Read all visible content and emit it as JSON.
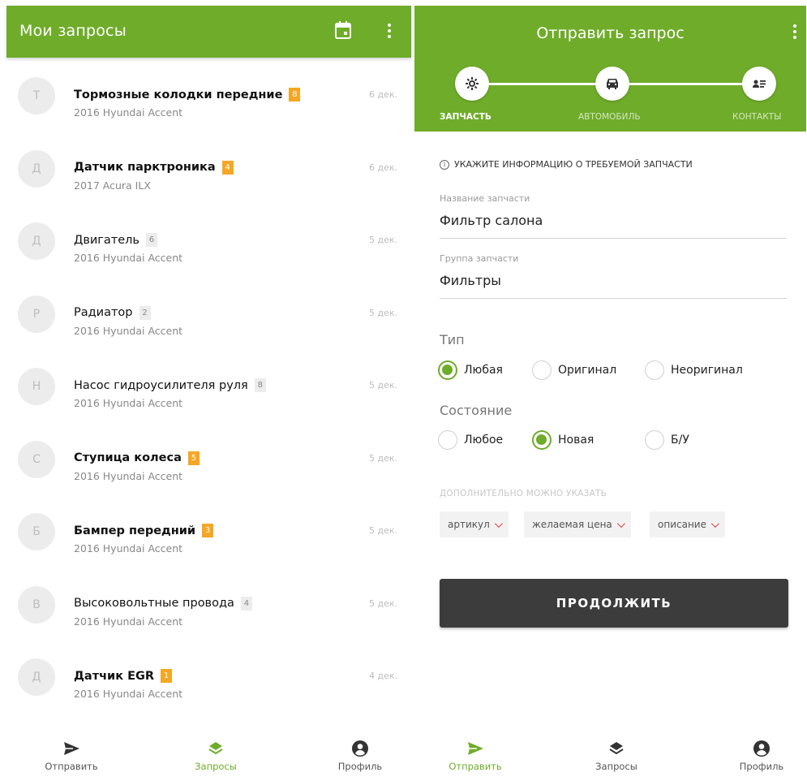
{
  "left": {
    "title": "Мои запросы",
    "icons": {
      "calendar": "calendar-icon",
      "more": "more-vert-icon"
    },
    "requests": [
      {
        "avatar": "Т",
        "name": "Тормозные колодки передние",
        "bold": true,
        "badge": "8",
        "badge_style": "orange",
        "car": "2016 Hyundai Accent",
        "date": "6 дек."
      },
      {
        "avatar": "Д",
        "name": "Датчик парктроника",
        "bold": true,
        "badge": "4",
        "badge_style": "orange",
        "car": "2017 Acura ILX",
        "date": "6 дек."
      },
      {
        "avatar": "Д",
        "name": "Двигатель",
        "bold": false,
        "badge": "6",
        "badge_style": "gray",
        "car": "2016 Hyundai Accent",
        "date": "5 дек."
      },
      {
        "avatar": "Р",
        "name": "Радиатор",
        "bold": false,
        "badge": "2",
        "badge_style": "gray",
        "car": "2016 Hyundai Accent",
        "date": "5 дек."
      },
      {
        "avatar": "Н",
        "name": "Насос гидроусилителя руля",
        "bold": false,
        "badge": "8",
        "badge_style": "gray",
        "car": "2016 Hyundai Accent",
        "date": "5 дек."
      },
      {
        "avatar": "С",
        "name": "Ступица колеса",
        "bold": true,
        "badge": "5",
        "badge_style": "orange",
        "car": "2016 Hyundai Accent",
        "date": "5 дек."
      },
      {
        "avatar": "Б",
        "name": "Бампер передний",
        "bold": true,
        "badge": "3",
        "badge_style": "orange",
        "car": "2016 Hyundai Accent",
        "date": "5 дек."
      },
      {
        "avatar": "В",
        "name": "Высоковольтные провода",
        "bold": false,
        "badge": "4",
        "badge_style": "gray",
        "car": "2016 Hyundai Accent",
        "date": "5 дек."
      },
      {
        "avatar": "Д",
        "name": "Датчик EGR",
        "bold": true,
        "badge": "1",
        "badge_style": "orange",
        "car": "2016 Hyundai Accent",
        "date": "4 дек."
      }
    ],
    "nav": [
      {
        "label": "Отправить",
        "icon": "send-icon",
        "active": false
      },
      {
        "label": "Запросы",
        "icon": "layers-icon",
        "active": true
      },
      {
        "label": "Профиль",
        "icon": "account-icon",
        "active": false
      }
    ]
  },
  "right": {
    "title": "Отправить запрос",
    "steps": [
      {
        "label": "ЗАПЧАСТЬ",
        "icon": "gear-icon",
        "active": true
      },
      {
        "label": "АВТОМОБИЛЬ",
        "icon": "car-icon",
        "active": false
      },
      {
        "label": "КОНТАКТЫ",
        "icon": "contacts-icon",
        "active": false
      }
    ],
    "hint": "УКАЖИТЕ ИНФОРМАЦИЮ О ТРЕБУЕМОЙ ЗАПЧАСТИ",
    "part_name": {
      "label": "Название запчасти",
      "value": "Фильтр салона"
    },
    "part_group": {
      "label": "Группа запчасти",
      "value": "Фильтры"
    },
    "type": {
      "label": "Тип",
      "options": [
        "Любая",
        "Оригинал",
        "Неоригинал"
      ],
      "selected": "Любая"
    },
    "condition": {
      "label": "Состояние",
      "options": [
        "Любое",
        "Новая",
        "Б/У"
      ],
      "selected": "Новая"
    },
    "extra_label": "ДОПОЛНИТЕЛЬНО МОЖНО УКАЗАТЬ",
    "chips": [
      "артикул",
      "желаемая цена",
      "описание"
    ],
    "continue_label": "ПРОДОЛЖИТЬ",
    "nav": [
      {
        "label": "Отправить",
        "icon": "send-icon",
        "active": true
      },
      {
        "label": "Запросы",
        "icon": "layers-icon",
        "active": false
      },
      {
        "label": "Профиль",
        "icon": "account-icon",
        "active": false
      }
    ]
  },
  "colors": {
    "accent": "#6fac2a",
    "badge_orange": "#f5a623",
    "button_dark": "#3c3c3c",
    "chip_chevron": "#e23b3b"
  }
}
